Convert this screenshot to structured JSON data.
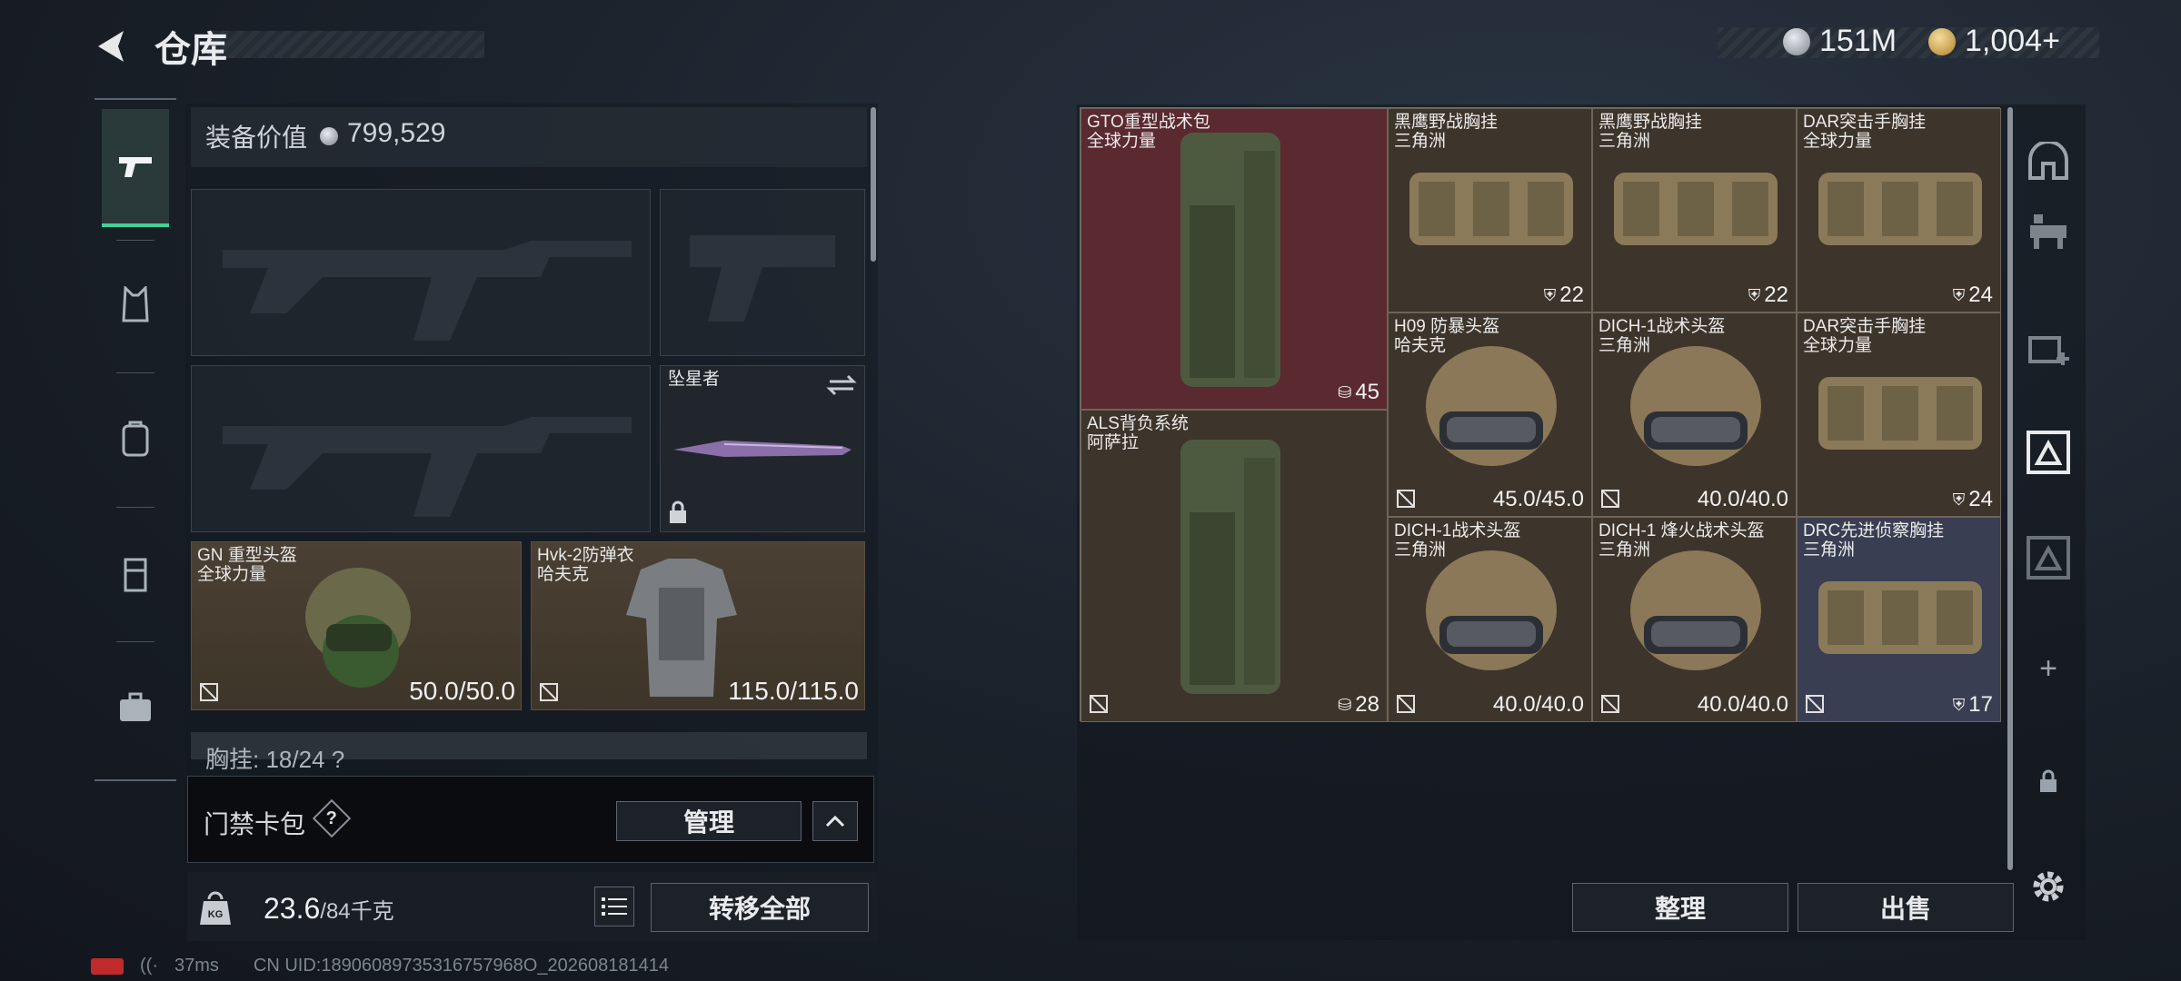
{
  "header": {
    "title": "仓库",
    "currency_silver": "151M",
    "currency_gold": "1,004+"
  },
  "colors": {
    "accent": "#3ed39a",
    "tan_slot": "#3e3529",
    "red_slot": "#5a2a30",
    "blue_slot": "#3a3e52"
  },
  "equip": {
    "value_label": "装备价值",
    "value": "799,529",
    "melee_name": "坠星者",
    "helmet": {
      "name": "GN 重型头盔",
      "maker": "全球力量",
      "durability": "50.0/50.0"
    },
    "armor": {
      "name": "Hvk-2防弹衣",
      "maker": "哈夫克",
      "durability": "115.0/115.0"
    },
    "chest_peek": "胸挂: 18/24 ?",
    "access_label": "门禁卡包",
    "manage_label": "管理",
    "weight": "23.6",
    "weight_max": "/84千克",
    "transfer_all": "转移全部"
  },
  "stash": {
    "items": [
      {
        "name": "GTO重型战术包",
        "maker": "全球力量",
        "count": "45",
        "kind": "backpack"
      },
      {
        "name": "黑鹰野战胸挂",
        "maker": "三角洲",
        "count": "22",
        "kind": "rig"
      },
      {
        "name": "黑鹰野战胸挂",
        "maker": "三角洲",
        "count": "22",
        "kind": "rig"
      },
      {
        "name": "DAR突击手胸挂",
        "maker": "全球力量",
        "count": "24",
        "kind": "rig"
      },
      {
        "name": "H09 防暴头盔",
        "maker": "哈夫克",
        "durability": "45.0/45.0",
        "kind": "helmet"
      },
      {
        "name": "DICH-1战术头盔",
        "maker": "三角洲",
        "durability": "40.0/40.0",
        "kind": "helmet"
      },
      {
        "name": "DAR突击手胸挂",
        "maker": "全球力量",
        "count": "24",
        "kind": "rig"
      },
      {
        "name": "ALS背负系统",
        "maker": "阿萨拉",
        "count": "28",
        "kind": "backpack"
      },
      {
        "name": "DICH-1战术头盔",
        "maker": "三角洲",
        "durability": "40.0/40.0",
        "kind": "helmet"
      },
      {
        "name": "DICH-1 烽火战术头盔",
        "maker": "三角洲",
        "durability": "40.0/40.0",
        "kind": "helmet"
      },
      {
        "name": "DRC先进侦察胸挂",
        "maker": "三角洲",
        "count": "17",
        "kind": "rig"
      }
    ],
    "sort_label": "整理",
    "sell_label": "出售"
  },
  "status": {
    "ping": "37ms",
    "uid": "CN UID:18906089735316757968O_202608181414"
  }
}
